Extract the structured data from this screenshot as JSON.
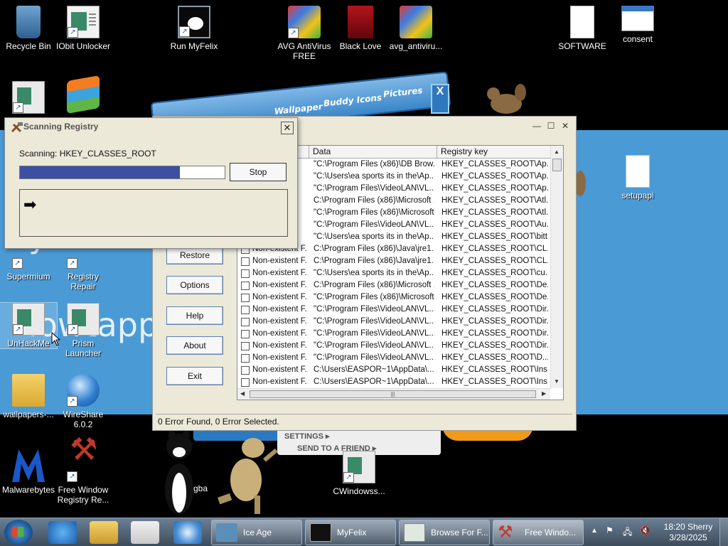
{
  "desktop": {
    "icons": [
      {
        "label": "Recycle Bin"
      },
      {
        "label": "IObit Unlocker"
      },
      {
        "label": "Run MyFelix"
      },
      {
        "label": "AVG AntiVirus FREE"
      },
      {
        "label": "Black Love"
      },
      {
        "label": "avg_antiviru..."
      },
      {
        "label": "SOFTWARE"
      },
      {
        "label": "consent"
      },
      {
        "label": "setupapi"
      },
      {
        "label": "Supermium"
      },
      {
        "label": "Registry Repair"
      },
      {
        "label": "UnHackMe"
      },
      {
        "label": "Prism Launcher"
      },
      {
        "label": "wallpapers-..."
      },
      {
        "label": "WireShare 6.0.2"
      },
      {
        "label": "Malwarebytes"
      },
      {
        "label": "Free Window Registry Re..."
      },
      {
        "label": "gba"
      },
      {
        "label": "CWindowss..."
      }
    ],
    "wallpaper": {
      "banner_items": [
        "Wallpaper",
        "Buddy Icons",
        "Pictures"
      ],
      "card_items": [
        "SETTINGS ▸",
        "SEND TO A FRIEND ▸"
      ],
      "bg_text_1": "yahoo",
      "bg_text_2": "lowtapp"
    }
  },
  "main_window": {
    "buttons": [
      "Restore",
      "Options",
      "Help",
      "About",
      "Exit"
    ],
    "columns": [
      "Data",
      "Registry key"
    ],
    "rows": [
      {
        "type": "",
        "data": "\"C:\\Program Files (x86)\\DB Brow...",
        "key": "HKEY_CLASSES_ROOT\\Ap..."
      },
      {
        "type": "",
        "data": "\"C:\\Users\\ea sports its in the\\Ap...",
        "key": "HKEY_CLASSES_ROOT\\Ap..."
      },
      {
        "type": "",
        "data": "\"C:\\Program Files\\VideoLAN\\VL...",
        "key": "HKEY_CLASSES_ROOT\\Ap..."
      },
      {
        "type": "",
        "data": "C:\\Program Files (x86)\\Microsoft ...",
        "key": "HKEY_CLASSES_ROOT\\Atl..."
      },
      {
        "type": "",
        "data": "\"C:\\Program Files (x86)\\Microsoft...",
        "key": "HKEY_CLASSES_ROOT\\Atl..."
      },
      {
        "type": "",
        "data": "\"C:\\Program Files\\VideoLAN\\VL...",
        "key": "HKEY_CLASSES_ROOT\\Au..."
      },
      {
        "type": "",
        "data": "\"C:\\Users\\ea sports its in the\\Ap...",
        "key": "HKEY_CLASSES_ROOT\\bitt..."
      },
      {
        "type": "Non-existent F...",
        "data": "C:\\Program Files (x86)\\Java\\jre1...",
        "key": "HKEY_CLASSES_ROOT\\CL..."
      },
      {
        "type": "Non-existent F...",
        "data": "C:\\Program Files (x86)\\Java\\jre1...",
        "key": "HKEY_CLASSES_ROOT\\CL..."
      },
      {
        "type": "Non-existent F...",
        "data": "\"C:\\Users\\ea sports its in the\\Ap...",
        "key": "HKEY_CLASSES_ROOT\\cu..."
      },
      {
        "type": "Non-existent F...",
        "data": "C:\\Program Files (x86)\\Microsoft ...",
        "key": "HKEY_CLASSES_ROOT\\De..."
      },
      {
        "type": "Non-existent F...",
        "data": "\"C:\\Program Files (x86)\\Microsoft...",
        "key": "HKEY_CLASSES_ROOT\\De..."
      },
      {
        "type": "Non-existent F...",
        "data": "\"C:\\Program Files\\VideoLAN\\VL...",
        "key": "HKEY_CLASSES_ROOT\\Dir..."
      },
      {
        "type": "Non-existent F...",
        "data": "\"C:\\Program Files\\VideoLAN\\VL...",
        "key": "HKEY_CLASSES_ROOT\\Dir..."
      },
      {
        "type": "Non-existent F...",
        "data": "\"C:\\Program Files\\VideoLAN\\VL...",
        "key": "HKEY_CLASSES_ROOT\\Dir..."
      },
      {
        "type": "Non-existent F...",
        "data": "\"C:\\Program Files\\VideoLAN\\VL...",
        "key": "HKEY_CLASSES_ROOT\\Dir..."
      },
      {
        "type": "Non-existent F...",
        "data": "\"C:\\Program Files\\VideoLAN\\VL...",
        "key": "HKEY_CLASSES_ROOT\\D..."
      },
      {
        "type": "Non-existent F...",
        "data": "C:\\Users\\EASPOR~1\\AppData\\...",
        "key": "HKEY_CLASSES_ROOT\\Ins..."
      },
      {
        "type": "Non-existent F...",
        "data": "C:\\Users\\EASPOR~1\\AppData\\...",
        "key": "HKEY_CLASSES_ROOT\\Ins..."
      }
    ],
    "status": "0 Error Found,  0 Error Selected."
  },
  "scan_dialog": {
    "title": "Scanning Registry",
    "scanning_label": "Scanning: HKEY_CLASSES_ROOT",
    "progress_percent": 78,
    "stop_label": "Stop",
    "close_glyph": "✕"
  },
  "taskbar": {
    "tasks": [
      {
        "label": "Ice Age"
      },
      {
        "label": "MyFelix"
      },
      {
        "label": "Browse For F..."
      },
      {
        "label": "Free Windo..."
      }
    ],
    "clock_line1": "18:20 Sherry",
    "clock_line2": "3/28/2025"
  },
  "colors": {
    "wallpaper_blue": "#4a9ad6",
    "progress_fill": "#3c4fa3",
    "window_face": "#ece9d8"
  }
}
